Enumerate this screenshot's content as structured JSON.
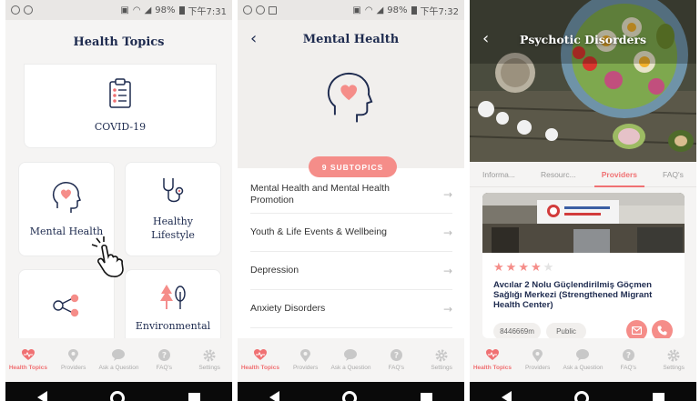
{
  "status": {
    "p1": {
      "battery": "98%",
      "time": "下午7:31"
    },
    "p2": {
      "battery": "98%",
      "time": "下午7:32"
    }
  },
  "screen1": {
    "title": "Health Topics",
    "cards": [
      {
        "label": "COVID-19",
        "icon": "clipboard-checklist-icon"
      },
      {
        "label": "Mental Health",
        "icon": "head-heart-icon"
      },
      {
        "label": "Healthy Lifestyle",
        "icon": "stethoscope-icon"
      },
      {
        "label": "",
        "icon": "network-people-icon"
      },
      {
        "label": "Environmental",
        "icon": "trees-icon"
      }
    ]
  },
  "screen2": {
    "title": "Mental Health",
    "subtopics_label": "9 SUBTOPICS",
    "items": [
      "Mental Health and Mental Health Promotion",
      "Youth & Life Events & Wellbeing",
      "Depression",
      "Anxiety Disorders"
    ]
  },
  "screen3": {
    "title": "Psychotic Disorders",
    "tabs": [
      "Informa...",
      "Resourc...",
      "Providers",
      "FAQ's"
    ],
    "active_tab": "Providers",
    "provider": {
      "name": "Avcılar 2 Nolu Güçlendirilmiş Göçmen Sağlığı Merkezi (Strengthened Migrant Health Center)",
      "rating": 4,
      "rating_max": 5,
      "distance": "8446669m",
      "type": "Public"
    }
  },
  "tabbar": {
    "items": [
      "Health Topics",
      "Providers",
      "Ask a Question",
      "FAQ's",
      "Settings"
    ],
    "active": "Health Topics"
  },
  "colors": {
    "accent": "#f07173",
    "navy": "#1e2b4f"
  }
}
